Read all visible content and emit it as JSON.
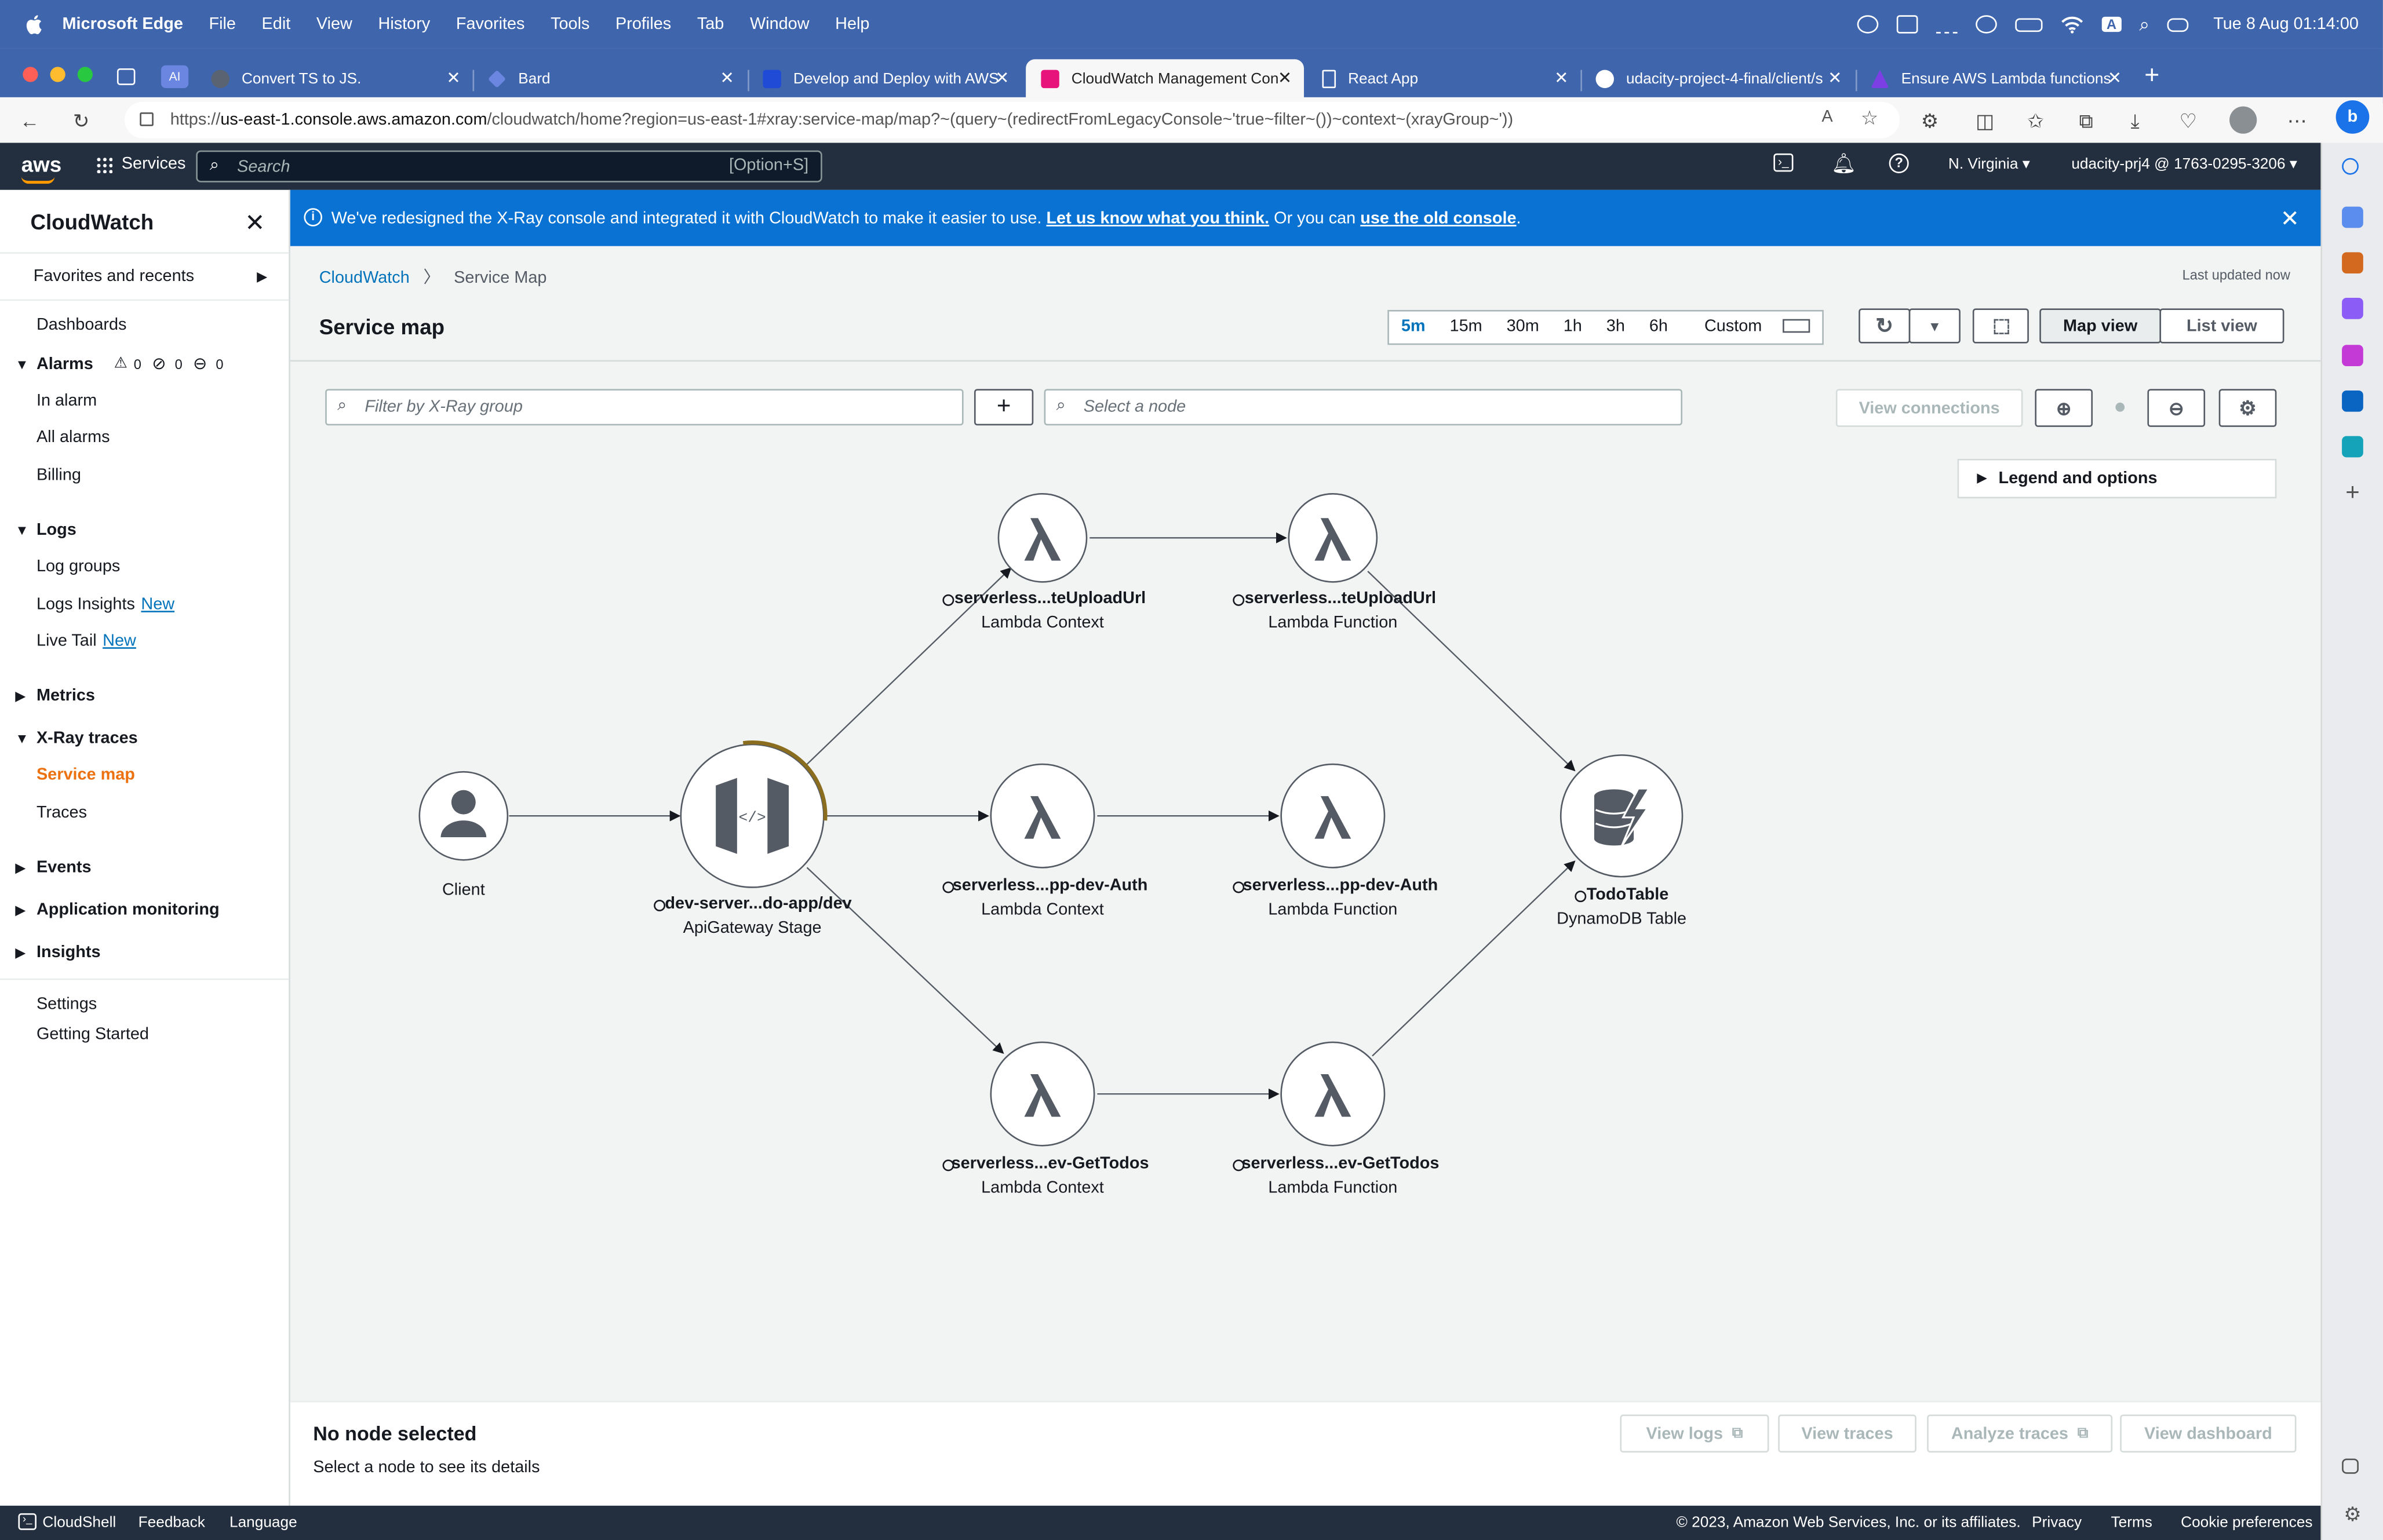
{
  "mac": {
    "app_name": "Microsoft Edge",
    "menus": [
      "File",
      "Edit",
      "View",
      "History",
      "Favorites",
      "Tools",
      "Profiles",
      "Tab",
      "Window",
      "Help"
    ],
    "datetime": "Tue 8 Aug  01:14:00"
  },
  "browser": {
    "tabs": [
      {
        "label": "Convert TS to JS.",
        "color": "#5a6372"
      },
      {
        "label": "Bard",
        "color": "#6b86e0"
      },
      {
        "label": "Develop and Deploy with AWS",
        "color": "#1f4bd6"
      },
      {
        "label": "CloudWatch Management Con",
        "color": "#e7157b"
      },
      {
        "label": "React App",
        "color": "#ffffff"
      },
      {
        "label": "udacity-project-4-final/client/s",
        "color": "#ffffff"
      },
      {
        "label": "Ensure AWS Lambda functions",
        "color": "#7b3fe4"
      }
    ],
    "url_prefix": "https://",
    "url_host": "us-east-1.console.aws.amazon.com",
    "url_path": "/cloudwatch/home?region=us-east-1#xray:service-map/map?~(query~(redirectFromLegacyConsole~'true~filter~())~context~(xrayGroup~'))"
  },
  "aws": {
    "logo": "aws",
    "services": "Services",
    "search_placeholder": "Search",
    "search_shortcut": "[Option+S]",
    "region": "N. Virginia ▾",
    "account": "udacity-prj4 @ 1763-0295-3206 ▾"
  },
  "nav": {
    "title": "CloudWatch",
    "favorites": "Favorites and recents",
    "dashboards": "Dashboards",
    "alarms": "Alarms",
    "alarm_counts": [
      "0",
      "0",
      "0"
    ],
    "in_alarm": "In alarm",
    "all_alarms": "All alarms",
    "billing": "Billing",
    "logs": "Logs",
    "log_groups": "Log groups",
    "logs_insights": "Logs Insights",
    "live_tail": "Live Tail",
    "new_tag": "New",
    "metrics": "Metrics",
    "xray": "X-Ray traces",
    "service_map": "Service map",
    "traces": "Traces",
    "events": "Events",
    "app_monitoring": "Application monitoring",
    "insights": "Insights",
    "settings": "Settings",
    "getting_started": "Getting Started"
  },
  "banner": {
    "text1": "We've redesigned the X-Ray console and integrated it with CloudWatch to make it easier to use. ",
    "link1": "Let us know what you think.",
    "text2": " Or you can ",
    "link2": "use the old console",
    "text3": "."
  },
  "page": {
    "breadcrumb_root": "CloudWatch",
    "breadcrumb_current": "Service Map",
    "last_updated": "Last updated now",
    "title": "Service map",
    "time_ranges": [
      "5m",
      "15m",
      "30m",
      "1h",
      "3h",
      "6h"
    ],
    "time_selected": "5m",
    "custom": "Custom",
    "map_view": "Map view",
    "list_view": "List view",
    "filter_placeholder": "Filter by X-Ray group",
    "node_placeholder": "Select a node",
    "view_connections": "View connections",
    "legend": "Legend and options"
  },
  "nodes": {
    "client": {
      "name": "Client"
    },
    "apigw": {
      "name": "dev-server...do-app/dev",
      "type": "ApiGateway Stage"
    },
    "ctx_upload": {
      "name": "serverless...teUploadUrl",
      "type": "Lambda Context"
    },
    "fn_upload": {
      "name": "serverless...teUploadUrl",
      "type": "Lambda Function"
    },
    "ctx_auth": {
      "name": "serverless...pp-dev-Auth",
      "type": "Lambda Context"
    },
    "fn_auth": {
      "name": "serverless...pp-dev-Auth",
      "type": "Lambda Function"
    },
    "ctx_todos": {
      "name": "serverless...ev-GetTodos",
      "type": "Lambda Context"
    },
    "fn_todos": {
      "name": "serverless...ev-GetTodos",
      "type": "Lambda Function"
    },
    "table": {
      "name": "TodoTable",
      "type": "DynamoDB Table"
    }
  },
  "details": {
    "heading": "No node selected",
    "sub": "Select a node to see its details",
    "view_logs": "View logs",
    "view_traces": "View traces",
    "analyze_traces": "Analyze traces",
    "view_dashboard": "View dashboard"
  },
  "footer": {
    "cloudshell": "CloudShell",
    "feedback": "Feedback",
    "language": "Language",
    "copyright": "© 2023, Amazon Web Services, Inc. or its affiliates.",
    "privacy": "Privacy",
    "terms": "Terms",
    "cookies": "Cookie preferences"
  }
}
